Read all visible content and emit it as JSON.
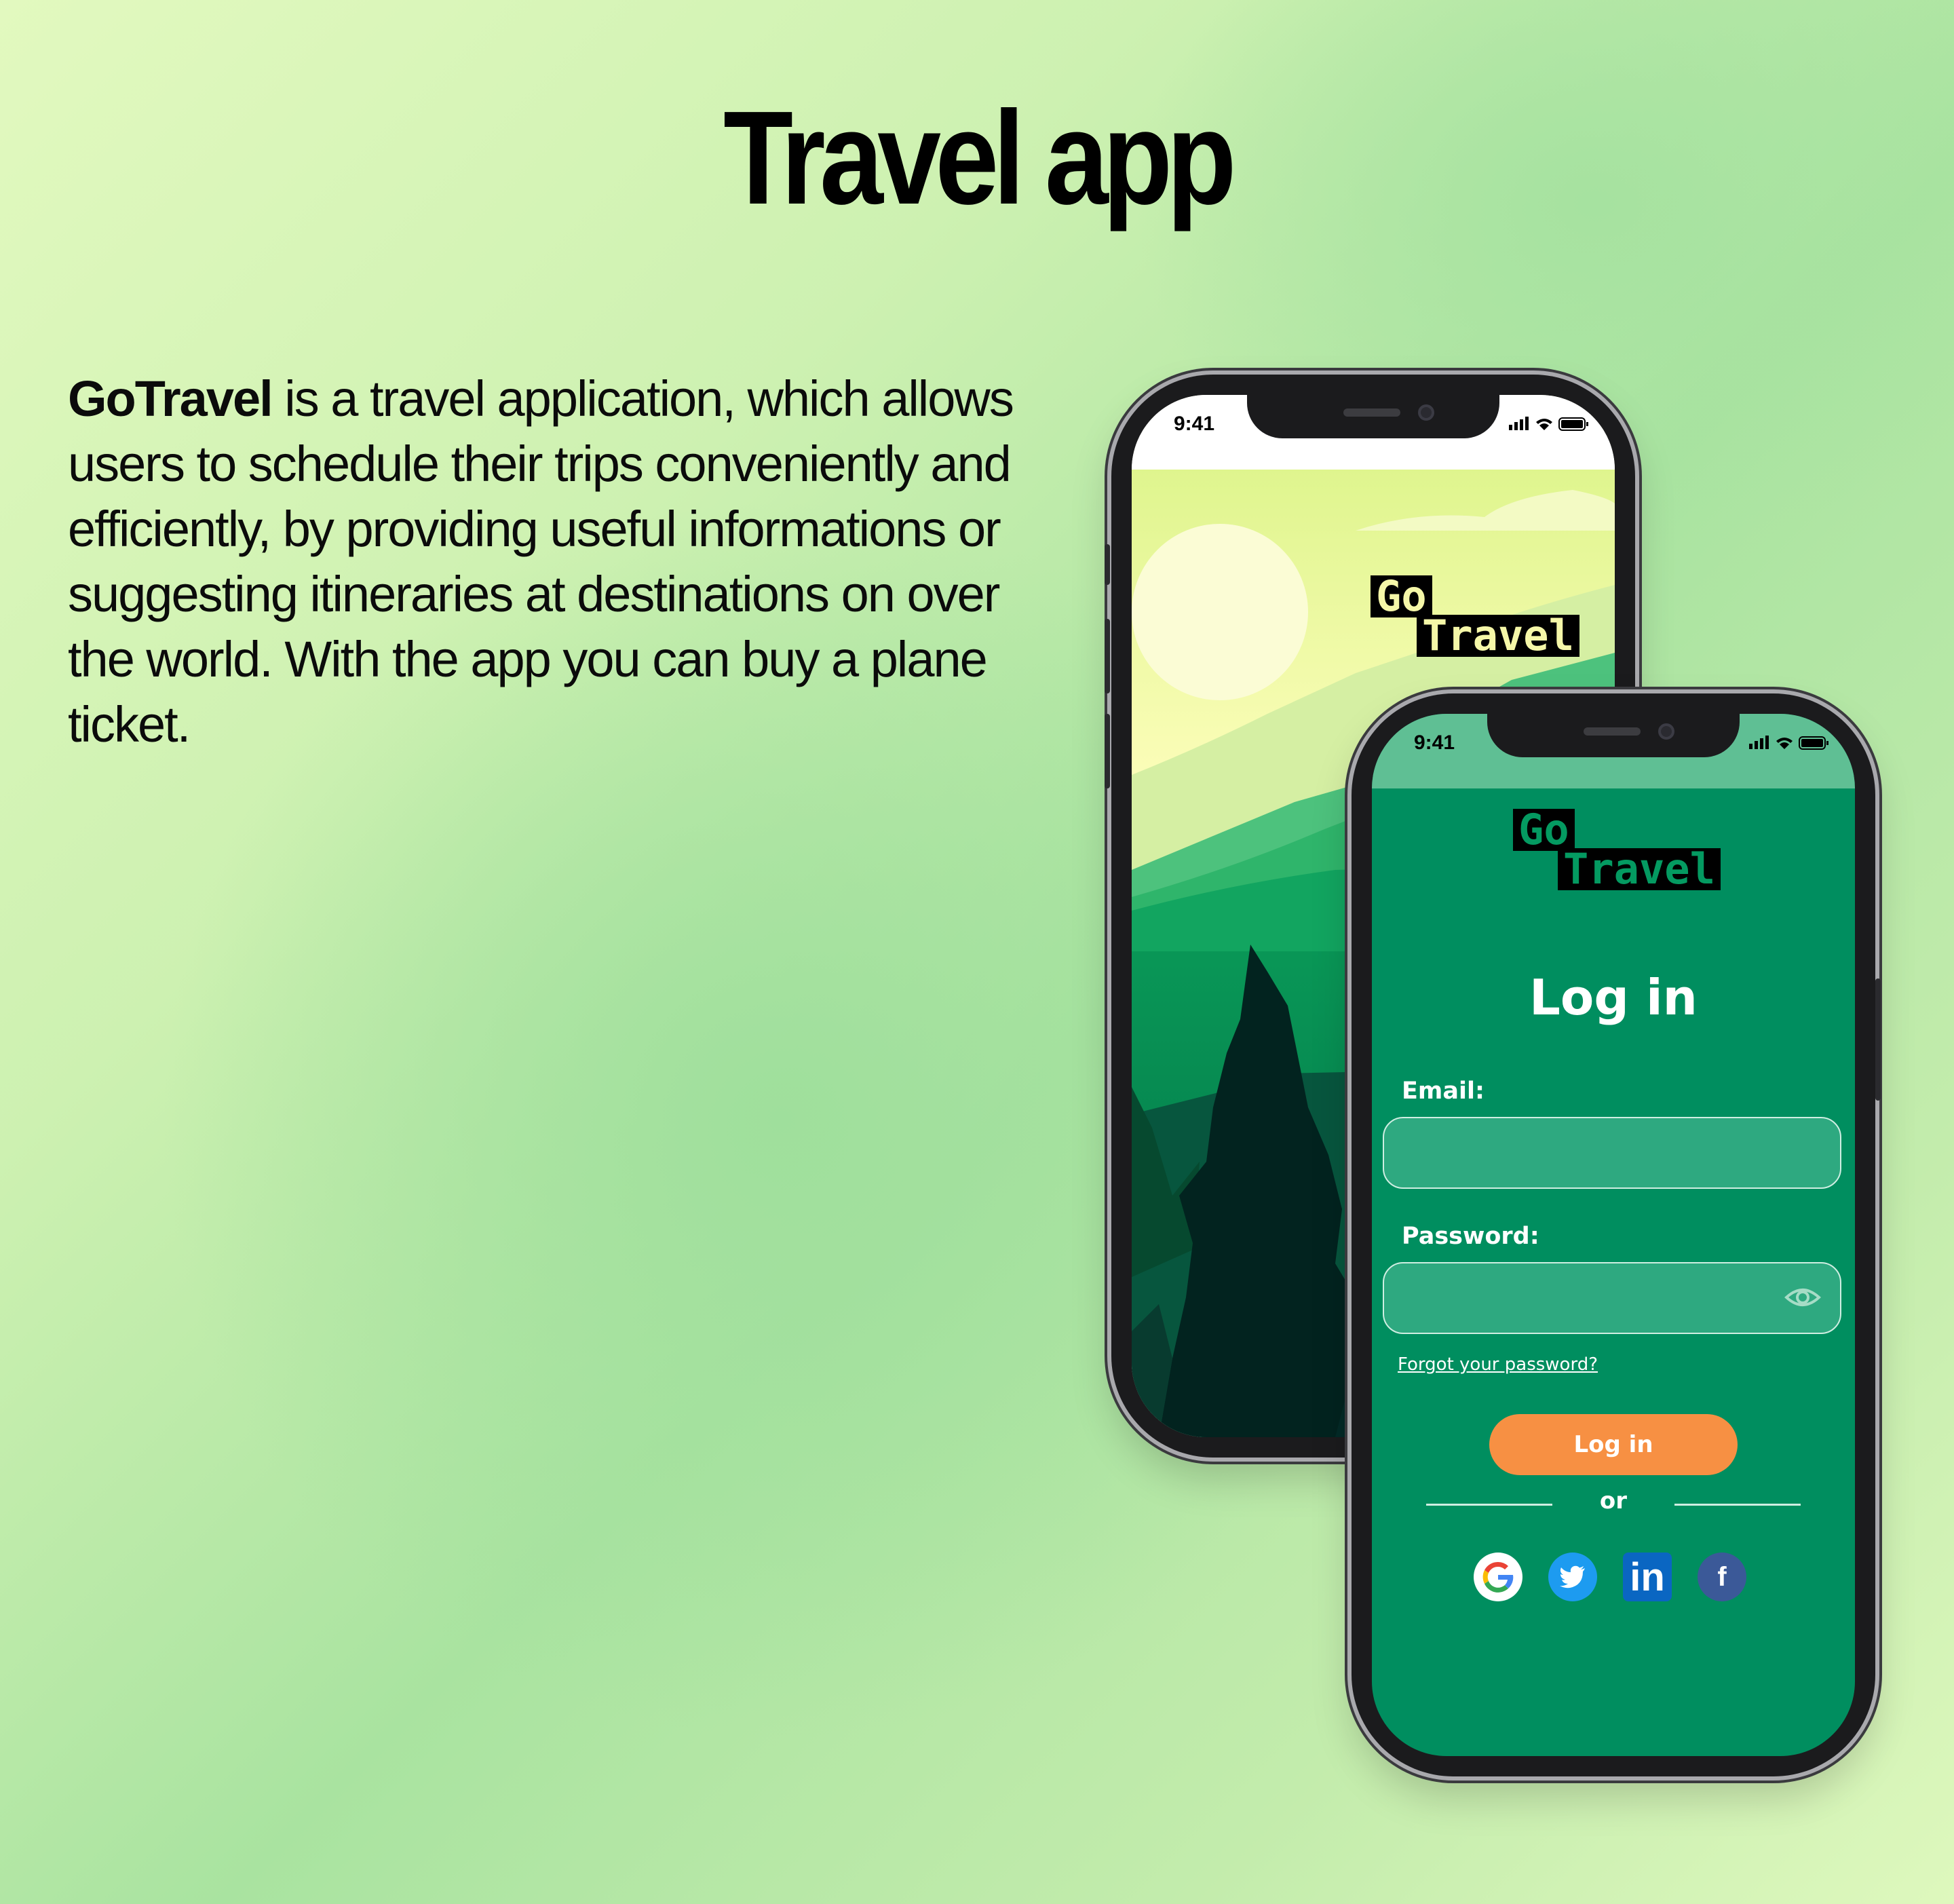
{
  "page": {
    "title": "Travel app",
    "description_brand": "GoTravel",
    "description_text": " is a travel application, which allows users to schedule their trips conveniently and efficiently, by providing useful informations or suggesting itineraries at destinations on over the world. With the app you can buy a plane ticket."
  },
  "splash": {
    "time": "9:41",
    "logo_go": "Go",
    "logo_travel": "Travel"
  },
  "login": {
    "time": "9:41",
    "logo_go": "Go",
    "logo_travel": "Travel",
    "title": "Log in",
    "email_label": "Email:",
    "email_value": "",
    "password_label": "Password:",
    "password_value": "",
    "forgot_link": "Forgot your password?",
    "login_button": "Log in",
    "or_text": "or",
    "social_icons": [
      "google-icon",
      "twitter-icon",
      "linkedin-icon",
      "facebook-icon"
    ]
  },
  "colors": {
    "app_green": "#008e5f",
    "field_green": "#2ea980",
    "accent_orange": "#f79043",
    "logo_yellow": "#f5f7a8"
  }
}
